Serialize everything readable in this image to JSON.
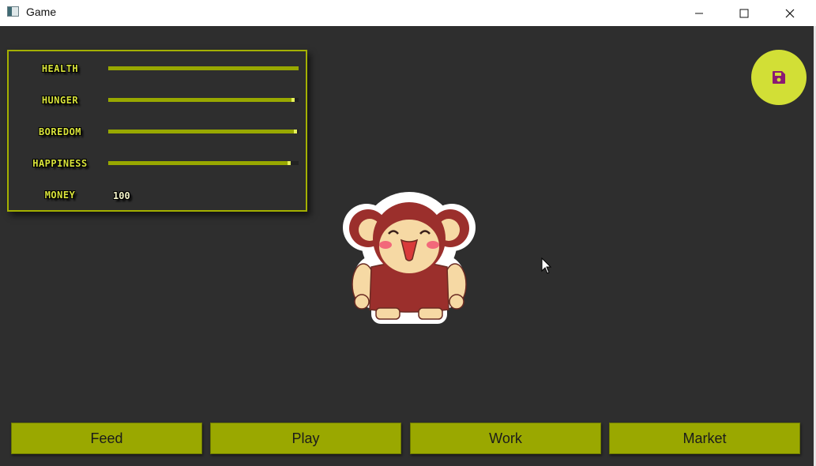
{
  "window": {
    "title": "Game"
  },
  "stats": [
    {
      "label": "HEALTH",
      "level": 1.0
    },
    {
      "label": "HUNGER",
      "level": 0.98
    },
    {
      "label": "BOREDOM",
      "level": 0.99
    },
    {
      "label": "HAPPINESS",
      "level": 0.96
    }
  ],
  "money": {
    "label": "MONEY",
    "value": "100"
  },
  "save_button": {
    "icon": "floppy-disk-icon"
  },
  "actions": {
    "feed": "Feed",
    "play": "Play",
    "work": "Work",
    "market": "Market"
  },
  "colors": {
    "background": "#2e2e2e",
    "accent": "#9aa800",
    "label": "#d7e23a",
    "save_fab": "#d2df36",
    "save_icon": "#8b1a73"
  }
}
